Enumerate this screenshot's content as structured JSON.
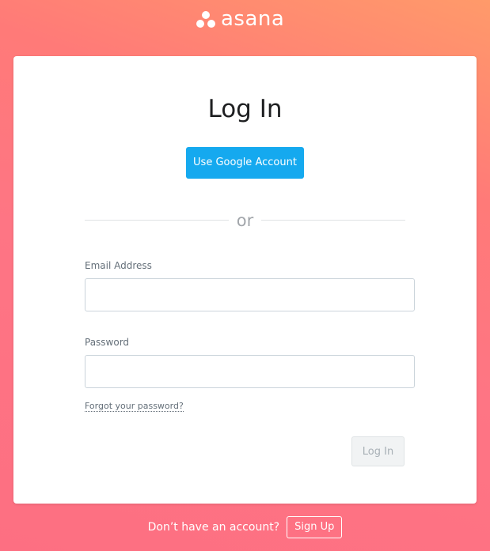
{
  "brand": {
    "logo_icon": "asana-three-dots-icon",
    "name": "asana",
    "gradient_colors": [
      "#ff9a6a",
      "#fd6f82"
    ]
  },
  "card": {
    "title": "Log In",
    "google_button_label": "Use Google Account",
    "google_button_color": "#15a9ef",
    "separator_text": "or",
    "email": {
      "label": "Email Address",
      "value": "",
      "placeholder": ""
    },
    "password": {
      "label": "Password",
      "value": "",
      "placeholder": ""
    },
    "forgot_password_link": "Forgot your password?",
    "login_button_label": "Log In"
  },
  "footer": {
    "prompt_text": "Don’t have an account?",
    "signup_button_label": "Sign Up"
  }
}
